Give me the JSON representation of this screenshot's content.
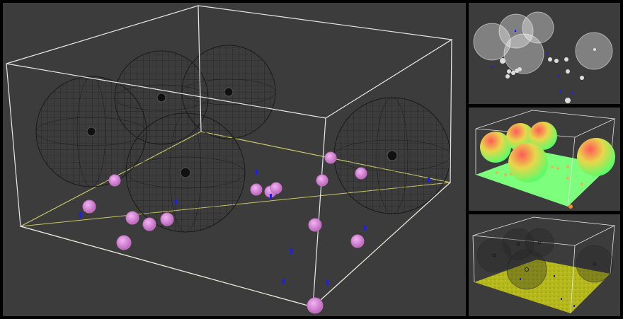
{
  "layout": {
    "type": "quad-viewport",
    "viewports": [
      "main-view",
      "top-view",
      "shaded-view",
      "floor-view"
    ]
  },
  "scene": {
    "background_color": "#3c3c3c",
    "box_edge_color": "#e8e8e8",
    "floor_line_color": "#d6d66a",
    "large_sphere_color": "#141414",
    "small_sphere_color": "#d68ad6",
    "marker_color": "#1c1cff",
    "top_view_sphere_color": "#ffffff",
    "shaded_floor_color": "#7dff7d",
    "shaded_sphere_gradient": [
      "#ff5a5a",
      "#e9d64a",
      "#4fff6a"
    ],
    "textured_floor_color": "#b5b81a",
    "large_sphere_count": 5,
    "small_sphere_count": 17,
    "marker_count": 11
  }
}
